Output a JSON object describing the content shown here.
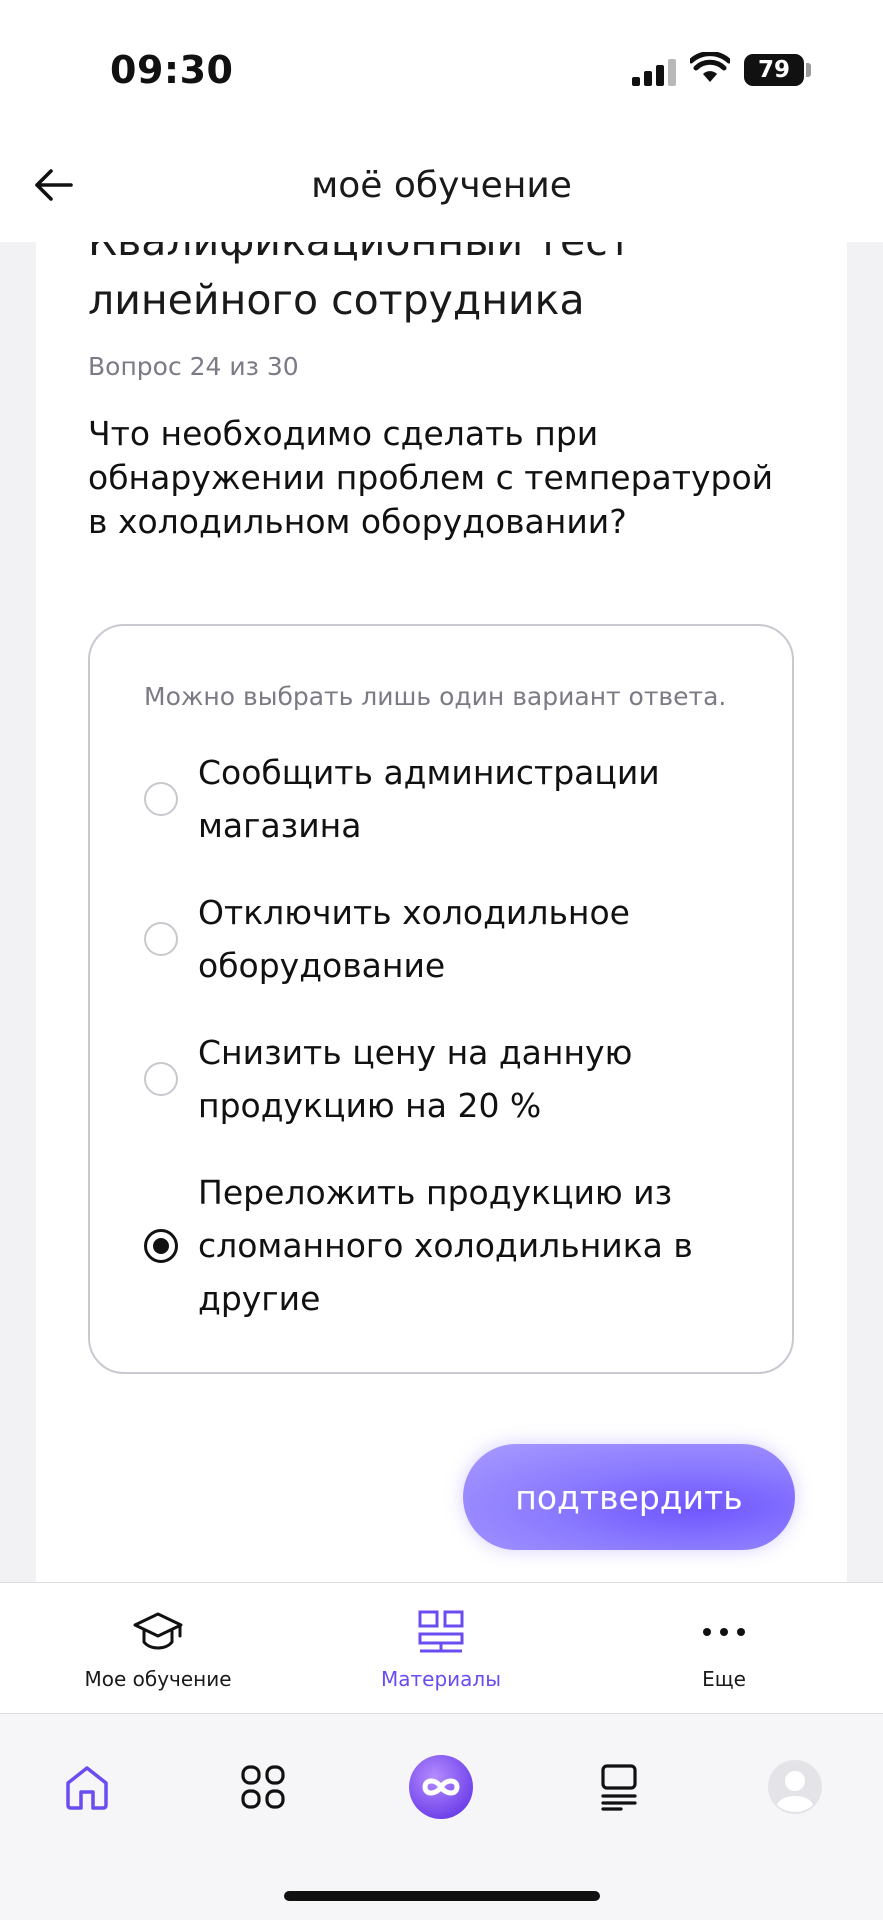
{
  "status_bar": {
    "time": "09:30",
    "battery": "79"
  },
  "header": {
    "title": "моё обучение",
    "back_icon": "arrow-left-icon"
  },
  "test": {
    "title": "Квалификационный тест линейного сотрудника",
    "counter": "Вопрос 24 из 30",
    "question": "Что необходимо сделать при обнаружении проблем с температурой в холодильном оборудовании?",
    "hint": "Можно выбрать лишь один вариант ответа.",
    "options": [
      {
        "label": "Сообщить администрации магазина",
        "selected": false
      },
      {
        "label": "Отключить холодильное оборудование",
        "selected": false
      },
      {
        "label": "Снизить цену на данную продукцию на 20 %",
        "selected": false
      },
      {
        "label": "Переложить продукцию из сломанного холодильника в другие",
        "selected": true
      }
    ],
    "confirm_label": "подтвердить"
  },
  "sub_nav": [
    {
      "label": "Мое обучение",
      "icon": "graduation-cap-icon",
      "active": false
    },
    {
      "label": "Материалы",
      "icon": "materials-grid-icon",
      "active": true
    },
    {
      "label": "Еще",
      "icon": "more-dots-icon",
      "active": false
    }
  ],
  "tab_bar": [
    "home-icon",
    "apps-grid-icon",
    "infinity-logo-icon",
    "book-list-icon",
    "avatar-icon"
  ],
  "colors": {
    "accent": "#6a4cf0",
    "button_gradient_center": "#6f55ff",
    "border": "#c9c9d1",
    "muted_text": "#7b7b85"
  }
}
